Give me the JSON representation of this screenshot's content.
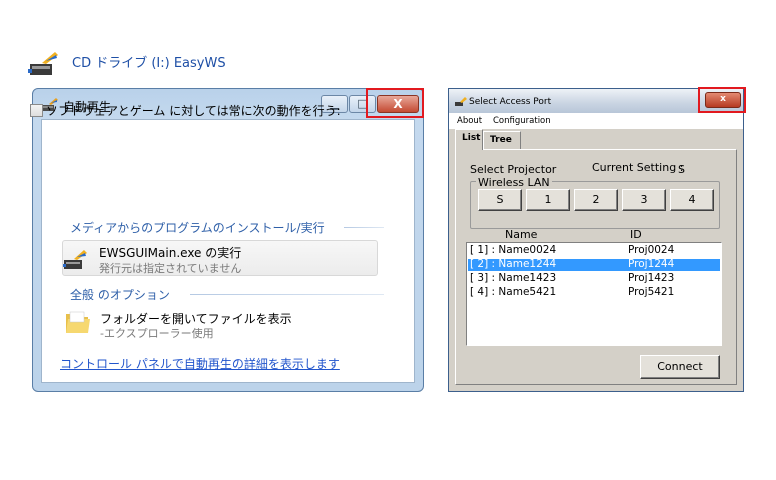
{
  "autoplay": {
    "title": "自動再生",
    "caption_min": "▁",
    "caption_max": "□",
    "caption_close": "X",
    "drive_title": "CD ドライブ (I:) EasyWS",
    "checkbox_label": "ソフトウェアとゲーム に対しては常に次の動作を行う:",
    "section_media": "メディアからのプログラムのインストール/実行",
    "action_title": "EWSGUIMain.exe の実行",
    "action_sub": "発行元は指定されていません",
    "section_general": "全般 のオプション",
    "folder_title": "フォルダーを開いてファイルを表示",
    "folder_sub": "-エクスプローラー使用",
    "control_panel_link": "コントロール パネルで自動再生の詳細を表示します"
  },
  "access_port": {
    "title": "Select Access Port",
    "close_label": "x",
    "menu": [
      "About",
      "Configuration"
    ],
    "tabs": [
      "List",
      "Tree"
    ],
    "select_projector_label": "Select Projector",
    "current_setting_label": "Current Setting :",
    "current_setting_value": "S",
    "wireless_lan_label": "Wireless LAN",
    "port_buttons": [
      "S",
      "1",
      "2",
      "3",
      "4"
    ],
    "list_headers": {
      "name": "Name",
      "id": "ID"
    },
    "rows": [
      {
        "name": "[ 1] : Name0024",
        "id": "Proj0024"
      },
      {
        "name": "[ 2] : Name1244",
        "id": "Proj1244"
      },
      {
        "name": "[ 3] : Name1423",
        "id": "Proj1423"
      },
      {
        "name": "[ 4] : Name5421",
        "id": "Proj5421"
      }
    ],
    "selected_row": 1,
    "connect_label": "Connect"
  },
  "colors": {
    "highlight_box": "#e2191f",
    "selection": "#3399ff",
    "link": "#2255cc"
  }
}
